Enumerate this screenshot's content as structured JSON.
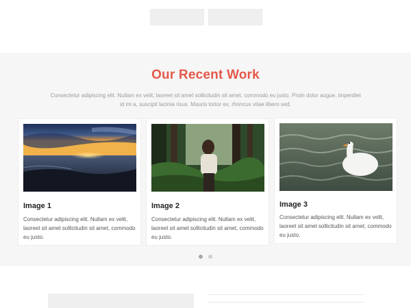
{
  "section": {
    "title": "Our Recent Work",
    "intro": "Consectetur adipiscing elit. Nullam ex velit, laoreet sit amet sollicitudin sit amet, commodo eu justo. Proin dolor augue, imperdiet id mi a, suscipit lacinia risus. Mauris tortor ex, rhoncus vitae libero sed."
  },
  "cards": [
    {
      "title": "Image 1",
      "text": "Consectetur adipiscing elit. Nullam ex velit, laoreet sit amet sollicitudin sit amet, commodo eu justo.",
      "image": "sunset-over-sea"
    },
    {
      "title": "Image 2",
      "text": "Consectetur adipiscing elit. Nullam ex velit, laoreet sit amet sollicitudin sit amet, commodo eu justo.",
      "image": "hiker-in-forest"
    },
    {
      "title": "Image 3",
      "text": "Consectetur adipiscing elit. Nullam ex velit, laoreet sit amet sollicitudin sit amet, commodo eu justo.",
      "image": "swan-on-water"
    }
  ],
  "carousel": {
    "pages": 2,
    "active_page": 1
  },
  "colors": {
    "accent": "#e4584a",
    "section_bg": "#f6f6f6",
    "placeholder": "#efefef"
  }
}
